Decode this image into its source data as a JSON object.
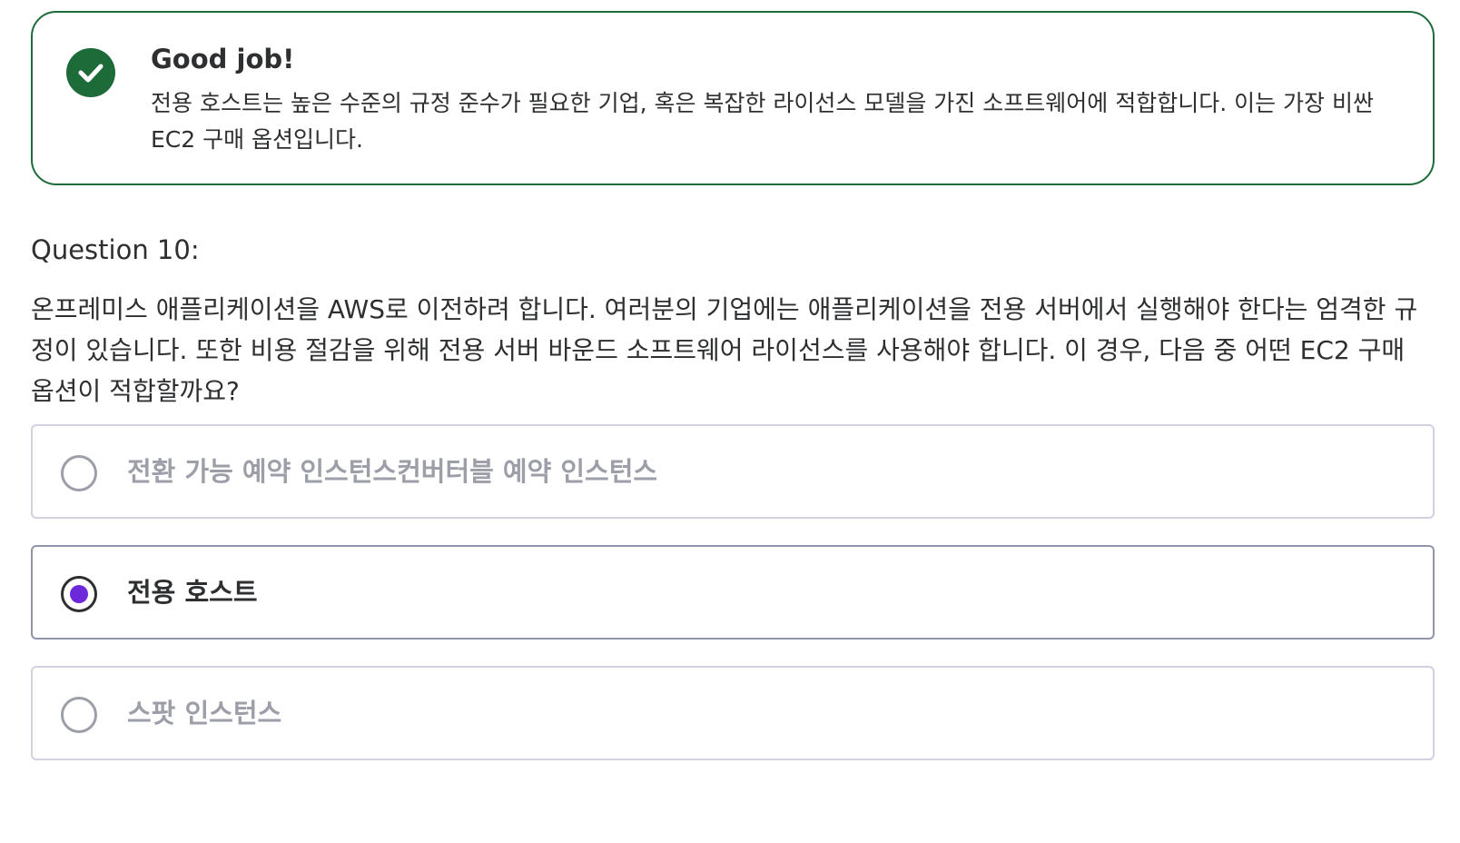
{
  "feedback": {
    "title": "Good job!",
    "body": "전용 호스트는 높은 수준의 규정 준수가 필요한 기업, 혹은 복잡한 라이선스 모델을 가진 소프트웨어에 적합합니다. 이는 가장 비싼 EC2 구매 옵션입니다.",
    "icon": "check-circle-icon",
    "accent_color": "#1e6b3a"
  },
  "question": {
    "label": "Question 10:",
    "text": "온프레미스 애플리케이션을 AWS로 이전하려 합니다. 여러분의 기업에는 애플리케이션을 전용 서버에서 실행해야 한다는 엄격한 규정이 있습니다. 또한 비용 절감을 위해 전용 서버 바운드 소프트웨어 라이선스를 사용해야 합니다. 이 경우, 다음 중 어떤 EC2 구매 옵션이 적합할까요?"
  },
  "options": [
    {
      "label": "전환 가능 예약 인스턴스컨버터블 예약 인스턴스",
      "selected": false
    },
    {
      "label": "전용 호스트",
      "selected": true
    },
    {
      "label": "스팟 인스턴스",
      "selected": false
    }
  ],
  "colors": {
    "selected_radio": "#6d28d9",
    "option_border": "#d1d2e0",
    "muted_text": "#9c9ea8"
  }
}
